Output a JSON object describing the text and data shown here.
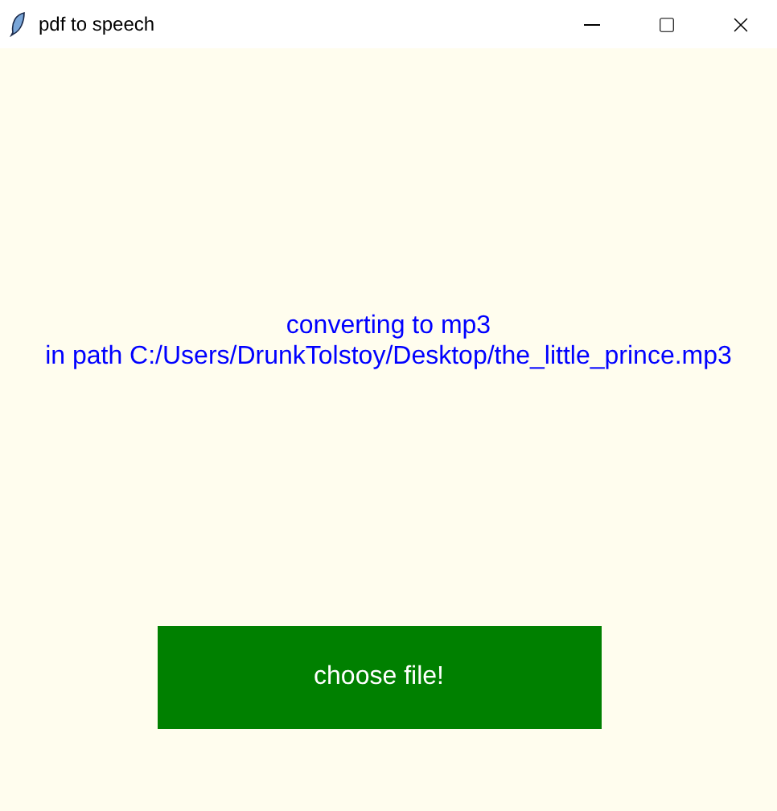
{
  "window": {
    "title": "pdf to speech"
  },
  "status_lines": [
    "converting to mp3",
    "in path C:/Users/DrunkTolstoy/Desktop/the_little_prince.mp3"
  ],
  "button": {
    "label": "choose file!"
  }
}
